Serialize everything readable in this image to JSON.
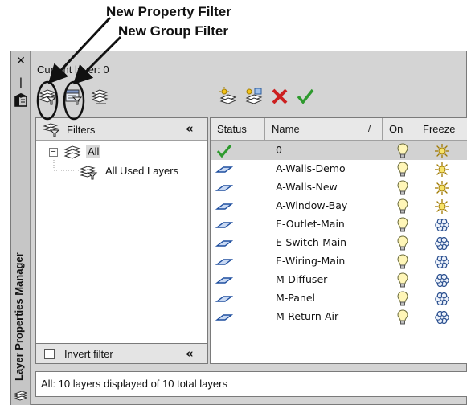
{
  "callouts": {
    "property_filter": "New Property Filter",
    "group_filter": "New Group Filter"
  },
  "palette": {
    "title": "Layer Properties Manager",
    "current_layer": "Current layer: 0"
  },
  "toolbar": {
    "left_icons": [
      "new-property-filter-icon",
      "new-group-filter-icon",
      "layer-states-manager-icon"
    ],
    "right_icons": [
      "new-layer-icon",
      "new-vp-frozen-layer-icon",
      "delete-layer-icon",
      "set-current-icon"
    ],
    "accent_delete": "#cc1f1f",
    "accent_check": "#2e9a2e"
  },
  "filters": {
    "header": "Filters",
    "tree": [
      {
        "label": "All",
        "selected": true
      },
      {
        "label": "All Used Layers"
      }
    ],
    "invert_label": "Invert filter",
    "invert_checked": false
  },
  "layers": {
    "columns": [
      "Status",
      "Name",
      "On",
      "Freeze"
    ],
    "rows": [
      {
        "status": "current",
        "name": "0",
        "on": true,
        "freeze": "thawed",
        "selected": true
      },
      {
        "status": "layer",
        "name": "A-Walls-Demo",
        "on": true,
        "freeze": "thawed"
      },
      {
        "status": "layer",
        "name": "A-Walls-New",
        "on": true,
        "freeze": "thawed"
      },
      {
        "status": "layer",
        "name": "A-Window-Bay",
        "on": true,
        "freeze": "thawed"
      },
      {
        "status": "layer",
        "name": "E-Outlet-Main",
        "on": true,
        "freeze": "frozen"
      },
      {
        "status": "layer",
        "name": "E-Switch-Main",
        "on": true,
        "freeze": "frozen"
      },
      {
        "status": "layer",
        "name": "E-Wiring-Main",
        "on": true,
        "freeze": "frozen"
      },
      {
        "status": "layer",
        "name": "M-Diffuser",
        "on": true,
        "freeze": "frozen"
      },
      {
        "status": "layer",
        "name": "M-Panel",
        "on": true,
        "freeze": "frozen"
      },
      {
        "status": "layer",
        "name": "M-Return-Air",
        "on": true,
        "freeze": "frozen"
      }
    ]
  },
  "statusbar": {
    "text": "All: 10 layers displayed of 10 total layers"
  }
}
